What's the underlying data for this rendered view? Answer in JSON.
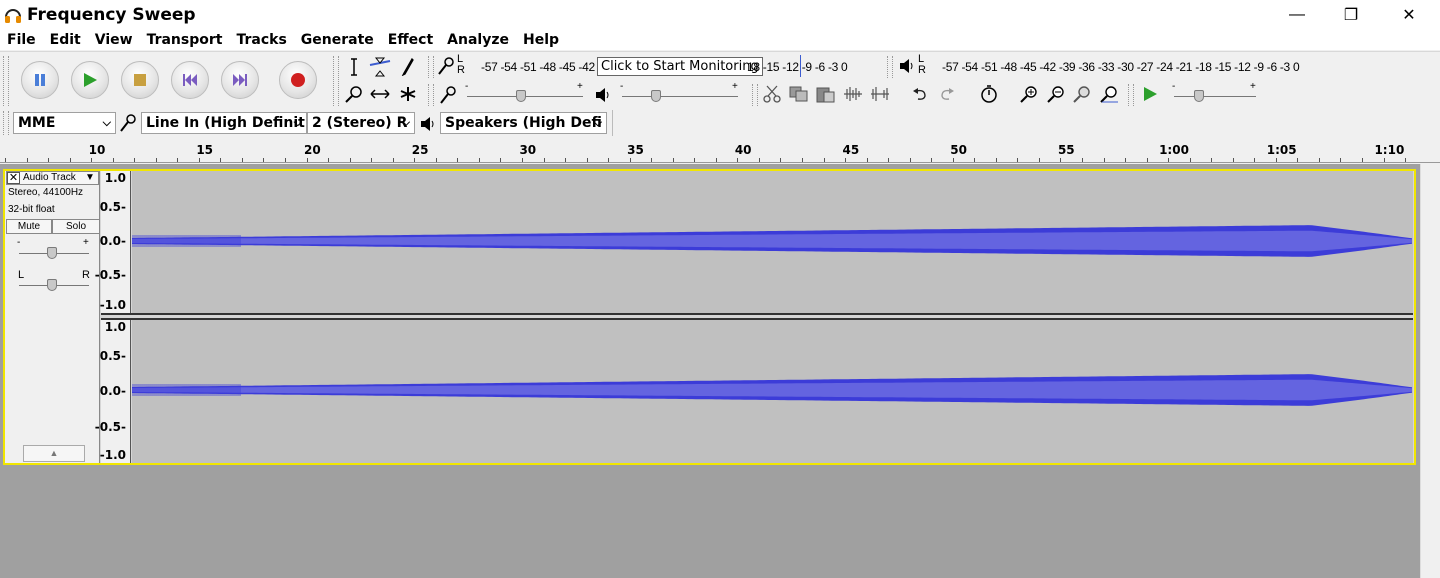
{
  "window": {
    "title": "Frequency Sweep",
    "minimize_glyph": "—",
    "maximize_glyph": "❐",
    "close_glyph": "✕"
  },
  "menu": [
    "File",
    "Edit",
    "View",
    "Transport",
    "Tracks",
    "Generate",
    "Effect",
    "Analyze",
    "Help"
  ],
  "transport": {
    "buttons": [
      "pause-icon",
      "play-icon",
      "stop-icon",
      "skip-start-icon",
      "skip-end-icon",
      "record-icon"
    ]
  },
  "tools": [
    "selection-tool-icon",
    "envelope-tool-icon",
    "draw-tool-icon",
    "zoom-tool-icon",
    "timeshift-tool-icon",
    "multi-tool-icon"
  ],
  "meters": {
    "record_scale": "-57 -54 -51 -48 -45 -42",
    "record_scale_tail": "18 -15 -12  -9  -6  -3  0",
    "monitor_tooltip": "Click to Start Monitoring",
    "playback_scale": "-57 -54 -51 -48 -45 -42 -39 -36 -33 -30 -27 -24 -21 -18 -15 -12  -9  -6  -3  0",
    "lr_label_l": "L",
    "lr_label_r": "R"
  },
  "mixer": {
    "minus": "-",
    "plus": "+"
  },
  "devices": {
    "host": "MME",
    "recording_device": "Line In (High Definit",
    "channels": "2 (Stereo) R",
    "playback_device": "Speakers (High Defi"
  },
  "ruler": {
    "labels": [
      "10",
      "15",
      "20",
      "25",
      "30",
      "35",
      "40",
      "45",
      "50",
      "55",
      "1:00",
      "1:05",
      "1:10"
    ]
  },
  "track": {
    "name": "Audio Track",
    "format": "Stereo, 44100Hz",
    "bitdepth": "32-bit float",
    "mute": "Mute",
    "solo": "Solo",
    "gain_minus": "-",
    "gain_plus": "+",
    "pan_l": "L",
    "pan_r": "R",
    "scale": [
      "1.0",
      "0.5-",
      "0.0-",
      "-0.5-",
      "-1.0"
    ],
    "wave_color": "#3c3cd8",
    "wave_color_light": "#6464e0"
  }
}
